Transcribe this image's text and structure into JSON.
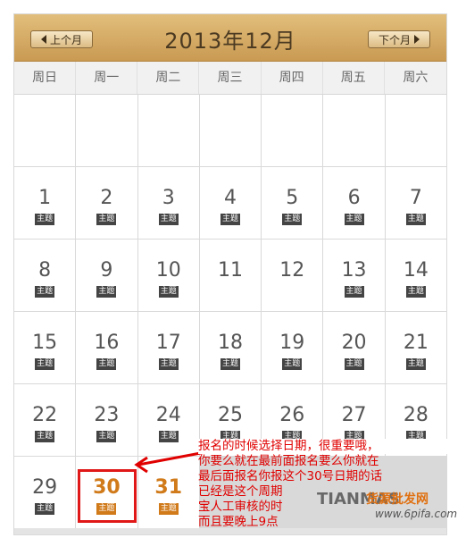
{
  "calendar": {
    "title": "2013年12月",
    "prev_label": "上个月",
    "next_label": "下个月",
    "weekdays": [
      "周日",
      "周一",
      "周二",
      "周三",
      "周四",
      "周五",
      "周六"
    ],
    "days": [
      {
        "num": "1",
        "tag": "主题"
      },
      {
        "num": "2",
        "tag": "主题"
      },
      {
        "num": "3",
        "tag": "主题"
      },
      {
        "num": "4",
        "tag": "主题"
      },
      {
        "num": "5",
        "tag": "主题"
      },
      {
        "num": "6",
        "tag": "主题"
      },
      {
        "num": "7",
        "tag": "主题"
      },
      {
        "num": "8",
        "tag": "主题"
      },
      {
        "num": "9",
        "tag": "主题"
      },
      {
        "num": "10",
        "tag": "主题"
      },
      {
        "num": "11",
        "tag": ""
      },
      {
        "num": "12",
        "tag": ""
      },
      {
        "num": "13",
        "tag": "主题"
      },
      {
        "num": "14",
        "tag": "主题"
      },
      {
        "num": "15",
        "tag": "主题"
      },
      {
        "num": "16",
        "tag": "主题"
      },
      {
        "num": "17",
        "tag": "主题"
      },
      {
        "num": "18",
        "tag": "主题"
      },
      {
        "num": "19",
        "tag": "主题"
      },
      {
        "num": "20",
        "tag": "主题"
      },
      {
        "num": "21",
        "tag": "主题"
      },
      {
        "num": "22",
        "tag": "主题"
      },
      {
        "num": "23",
        "tag": "主题"
      },
      {
        "num": "24",
        "tag": "主题"
      },
      {
        "num": "25",
        "tag": "主题"
      },
      {
        "num": "26",
        "tag": "主题"
      },
      {
        "num": "27",
        "tag": "主题"
      },
      {
        "num": "28",
        "tag": "主题"
      },
      {
        "num": "29",
        "tag": "主题"
      },
      {
        "num": "30",
        "tag": "主题"
      },
      {
        "num": "31",
        "tag": "主题"
      }
    ],
    "highlighted_days": [
      "30",
      "31"
    ],
    "selected_day": "30",
    "accent_color": "#d07a1a"
  },
  "annotation": {
    "lines": [
      "报名的时候选择日期，很重要哦，",
      "你要么就在最前面报名要么你就在",
      "最后面报名你报这个30号日期的话",
      "已经是这个周期",
      "宝人工审核的时",
      "而且要晚上9点"
    ],
    "color": "#e00000"
  },
  "watermark": {
    "brand": "TIANMAS",
    "cn": "货源批发网",
    "url": "www.6pifa.com"
  }
}
